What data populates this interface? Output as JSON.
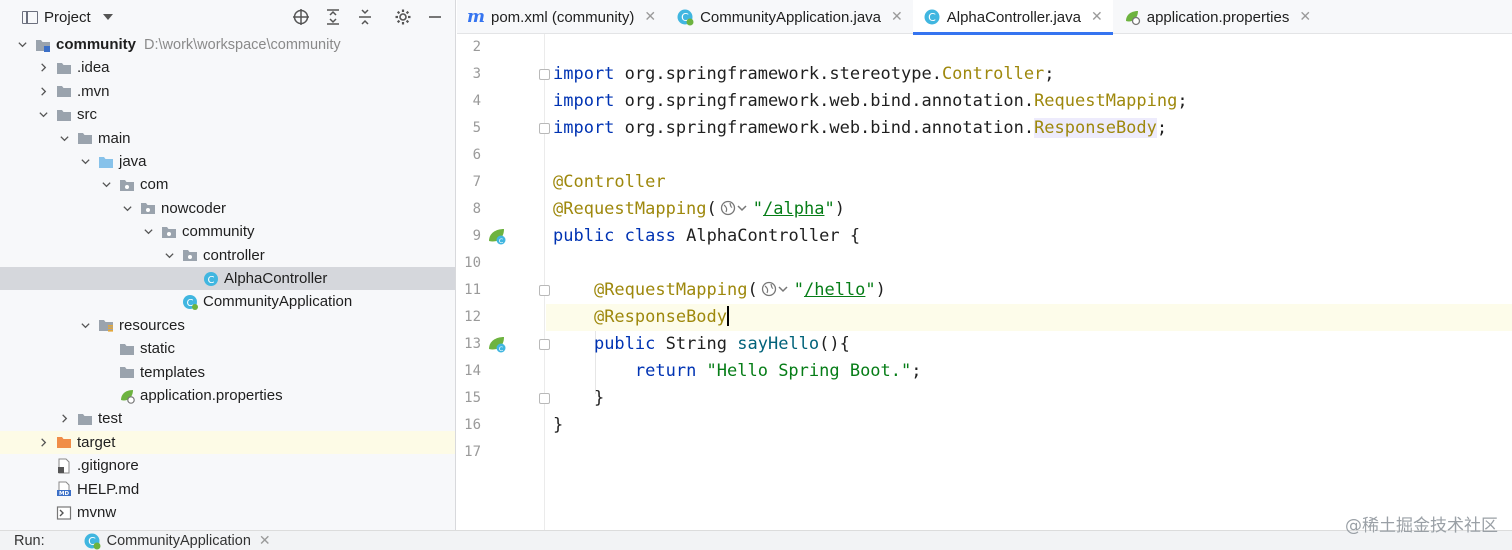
{
  "project_panel": {
    "title": "Project",
    "tree": [
      {
        "label": "community",
        "path": "D:\\work\\workspace\\community",
        "depth": 0,
        "expanded": true,
        "icon": "module-folder-icon",
        "bold": true
      },
      {
        "label": ".idea",
        "depth": 1,
        "expanded": false,
        "icon": "folder-icon"
      },
      {
        "label": ".mvn",
        "depth": 1,
        "expanded": false,
        "icon": "folder-icon"
      },
      {
        "label": "src",
        "depth": 1,
        "expanded": true,
        "icon": "folder-icon"
      },
      {
        "label": "main",
        "depth": 2,
        "expanded": true,
        "icon": "folder-icon"
      },
      {
        "label": "java",
        "depth": 3,
        "expanded": true,
        "icon": "source-folder-icon"
      },
      {
        "label": "com",
        "depth": 4,
        "expanded": true,
        "icon": "package-icon"
      },
      {
        "label": "nowcoder",
        "depth": 5,
        "expanded": true,
        "icon": "package-icon"
      },
      {
        "label": "community",
        "depth": 6,
        "expanded": true,
        "icon": "package-icon"
      },
      {
        "label": "controller",
        "depth": 7,
        "expanded": true,
        "icon": "package-icon"
      },
      {
        "label": "AlphaController",
        "depth": 8,
        "leaf": true,
        "icon": "java-class-icon",
        "selected": true
      },
      {
        "label": "CommunityApplication",
        "depth": 7,
        "leaf": true,
        "icon": "spring-boot-class-icon"
      },
      {
        "label": "resources",
        "depth": 3,
        "expanded": true,
        "icon": "resources-folder-icon"
      },
      {
        "label": "static",
        "depth": 4,
        "leaf": true,
        "icon": "folder-icon"
      },
      {
        "label": "templates",
        "depth": 4,
        "leaf": true,
        "icon": "folder-icon"
      },
      {
        "label": "application.properties",
        "depth": 4,
        "leaf": true,
        "icon": "spring-properties-icon"
      },
      {
        "label": "test",
        "depth": 2,
        "expanded": false,
        "icon": "folder-icon"
      },
      {
        "label": "target",
        "depth": 1,
        "expanded": false,
        "icon": "excluded-folder-icon",
        "highlight": true
      },
      {
        "label": ".gitignore",
        "depth": 1,
        "leaf": true,
        "icon": "gitignore-file-icon"
      },
      {
        "label": "HELP.md",
        "depth": 1,
        "leaf": true,
        "icon": "markdown-file-icon"
      },
      {
        "label": "mvnw",
        "depth": 1,
        "leaf": true,
        "icon": "script-file-icon"
      }
    ]
  },
  "tabs": [
    {
      "label": "pom.xml (community)",
      "icon": "maven-icon",
      "active": false
    },
    {
      "label": "CommunityApplication.java",
      "icon": "spring-boot-class-icon",
      "active": false
    },
    {
      "label": "AlphaController.java",
      "icon": "java-class-icon",
      "active": true
    },
    {
      "label": "application.properties",
      "icon": "spring-properties-icon",
      "active": false
    }
  ],
  "editor": {
    "line_numbers": [
      "2",
      "3",
      "4",
      "5",
      "6",
      "7",
      "8",
      "9",
      "10",
      "11",
      "12",
      "13",
      "14",
      "15",
      "16",
      "17"
    ],
    "current_line": "12",
    "code": {
      "l3_kw": "import",
      "l3_pkg": " org.springframework.stereotype.",
      "l3_cls": "Controller",
      "l3_end": ";",
      "l4_kw": "import",
      "l4_pkg": " org.springframework.web.bind.annotation.",
      "l4_cls": "RequestMapping",
      "l4_end": ";",
      "l5_kw": "import",
      "l5_pkg": " org.springframework.web.bind.annotation.",
      "l5_cls": "ResponseBody",
      "l5_end": ";",
      "l7_ann": "@Controller",
      "l8_ann": "@RequestMapping",
      "l8_open": "(",
      "l8_q1": "\"",
      "l8_path": "/alpha",
      "l8_q2": "\"",
      "l8_close": ")",
      "l9_kw1": "public",
      "l9_kw2": "class",
      "l9_name": " AlphaController {",
      "l11_ann": "@RequestMapping",
      "l11_open": "(",
      "l11_q1": "\"",
      "l11_path": "/hello",
      "l11_q2": "\"",
      "l11_close": ")",
      "l12_ann": "@ResponseBody",
      "l13_kw": "public",
      "l13_rest": " String ",
      "l13_method": "sayHello",
      "l13_end": "(){",
      "l14_kw": "return",
      "l14_str": " \"Hello Spring Boot.\"",
      "l14_end": ";",
      "l15": "}",
      "l16": "}"
    }
  },
  "run_bar": {
    "label": "Run:",
    "config": "CommunityApplication"
  },
  "watermark": "@稀土掘金技术社区",
  "colors": {
    "keyword": "#0033b3",
    "annotation": "#9e880d",
    "string": "#067d17",
    "accent": "#3574f0",
    "selection": "#d5d7dc"
  }
}
